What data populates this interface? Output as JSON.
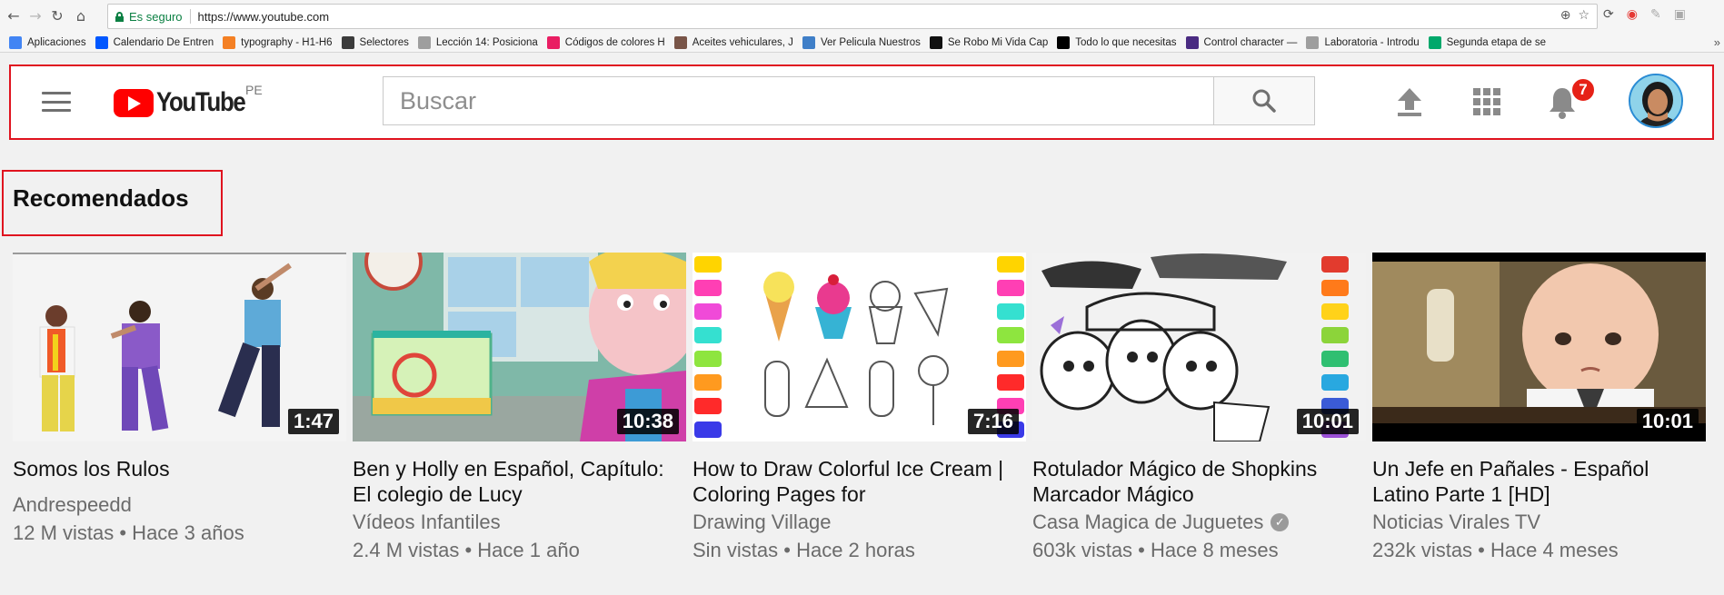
{
  "browser": {
    "secure_label": "Es seguro",
    "url": "https://www.youtube.com",
    "bookmarks": [
      {
        "label": "Aplicaciones",
        "color": "#4285f4"
      },
      {
        "label": "Calendario De Entren",
        "color": "#0057ff"
      },
      {
        "label": "typography - H1-H6",
        "color": "#f48024"
      },
      {
        "label": "Selectores",
        "color": "#3c3c3c"
      },
      {
        "label": "Lección 14: Posiciona",
        "color": "#9e9e9e"
      },
      {
        "label": "Códigos de colores H",
        "color": "#e91e63"
      },
      {
        "label": "Aceites vehiculares, J",
        "color": "#795548"
      },
      {
        "label": "Ver Pelicula Nuestros",
        "color": "#3f7fc8"
      },
      {
        "label": "Se Robo Mi Vida Cap",
        "color": "#111111"
      },
      {
        "label": "Todo lo que necesitas",
        "color": "#000000"
      },
      {
        "label": "Control character — ",
        "color": "#4a2b82"
      },
      {
        "label": "Laboratoria - Introdu",
        "color": "#9e9e9e"
      },
      {
        "label": "Segunda etapa de se",
        "color": "#00a86b"
      }
    ]
  },
  "header": {
    "logo_text": "YouTube",
    "country_code": "PE",
    "search_placeholder": "Buscar",
    "notification_count": "7"
  },
  "section": {
    "title": "Recomendados"
  },
  "videos": [
    {
      "title": "Somos los Rulos",
      "channel": "Andrespeedd",
      "meta": "12 M vistas • Hace 3 años",
      "duration": "1:47",
      "verified": false
    },
    {
      "title": "Ben y Holly en Español, Capítulo: El colegio de Lucy",
      "channel": "Vídeos Infantiles",
      "meta": "2.4 M vistas • Hace 1 año",
      "duration": "10:38",
      "verified": false
    },
    {
      "title": "How to Draw Colorful Ice Cream | Coloring Pages for",
      "channel": "Drawing Village",
      "meta": "Sin vistas • Hace 2 horas",
      "duration": "7:16",
      "verified": false
    },
    {
      "title": "Rotulador Mágico de Shopkins Marcador Mágico",
      "channel": "Casa Magica de Juguetes",
      "meta": "603k vistas • Hace 8 meses",
      "duration": "10:01",
      "verified": true
    },
    {
      "title": "Un Jefe en Pañales - Español Latino Parte 1 [HD]",
      "channel": "Noticias Virales TV",
      "meta": "232k vistas • Hace 4 meses",
      "duration": "10:01",
      "verified": false
    }
  ],
  "colors": {
    "brand_red": "#ff0000",
    "highlight_border": "#e0131f",
    "background": "#f1f1f1"
  }
}
